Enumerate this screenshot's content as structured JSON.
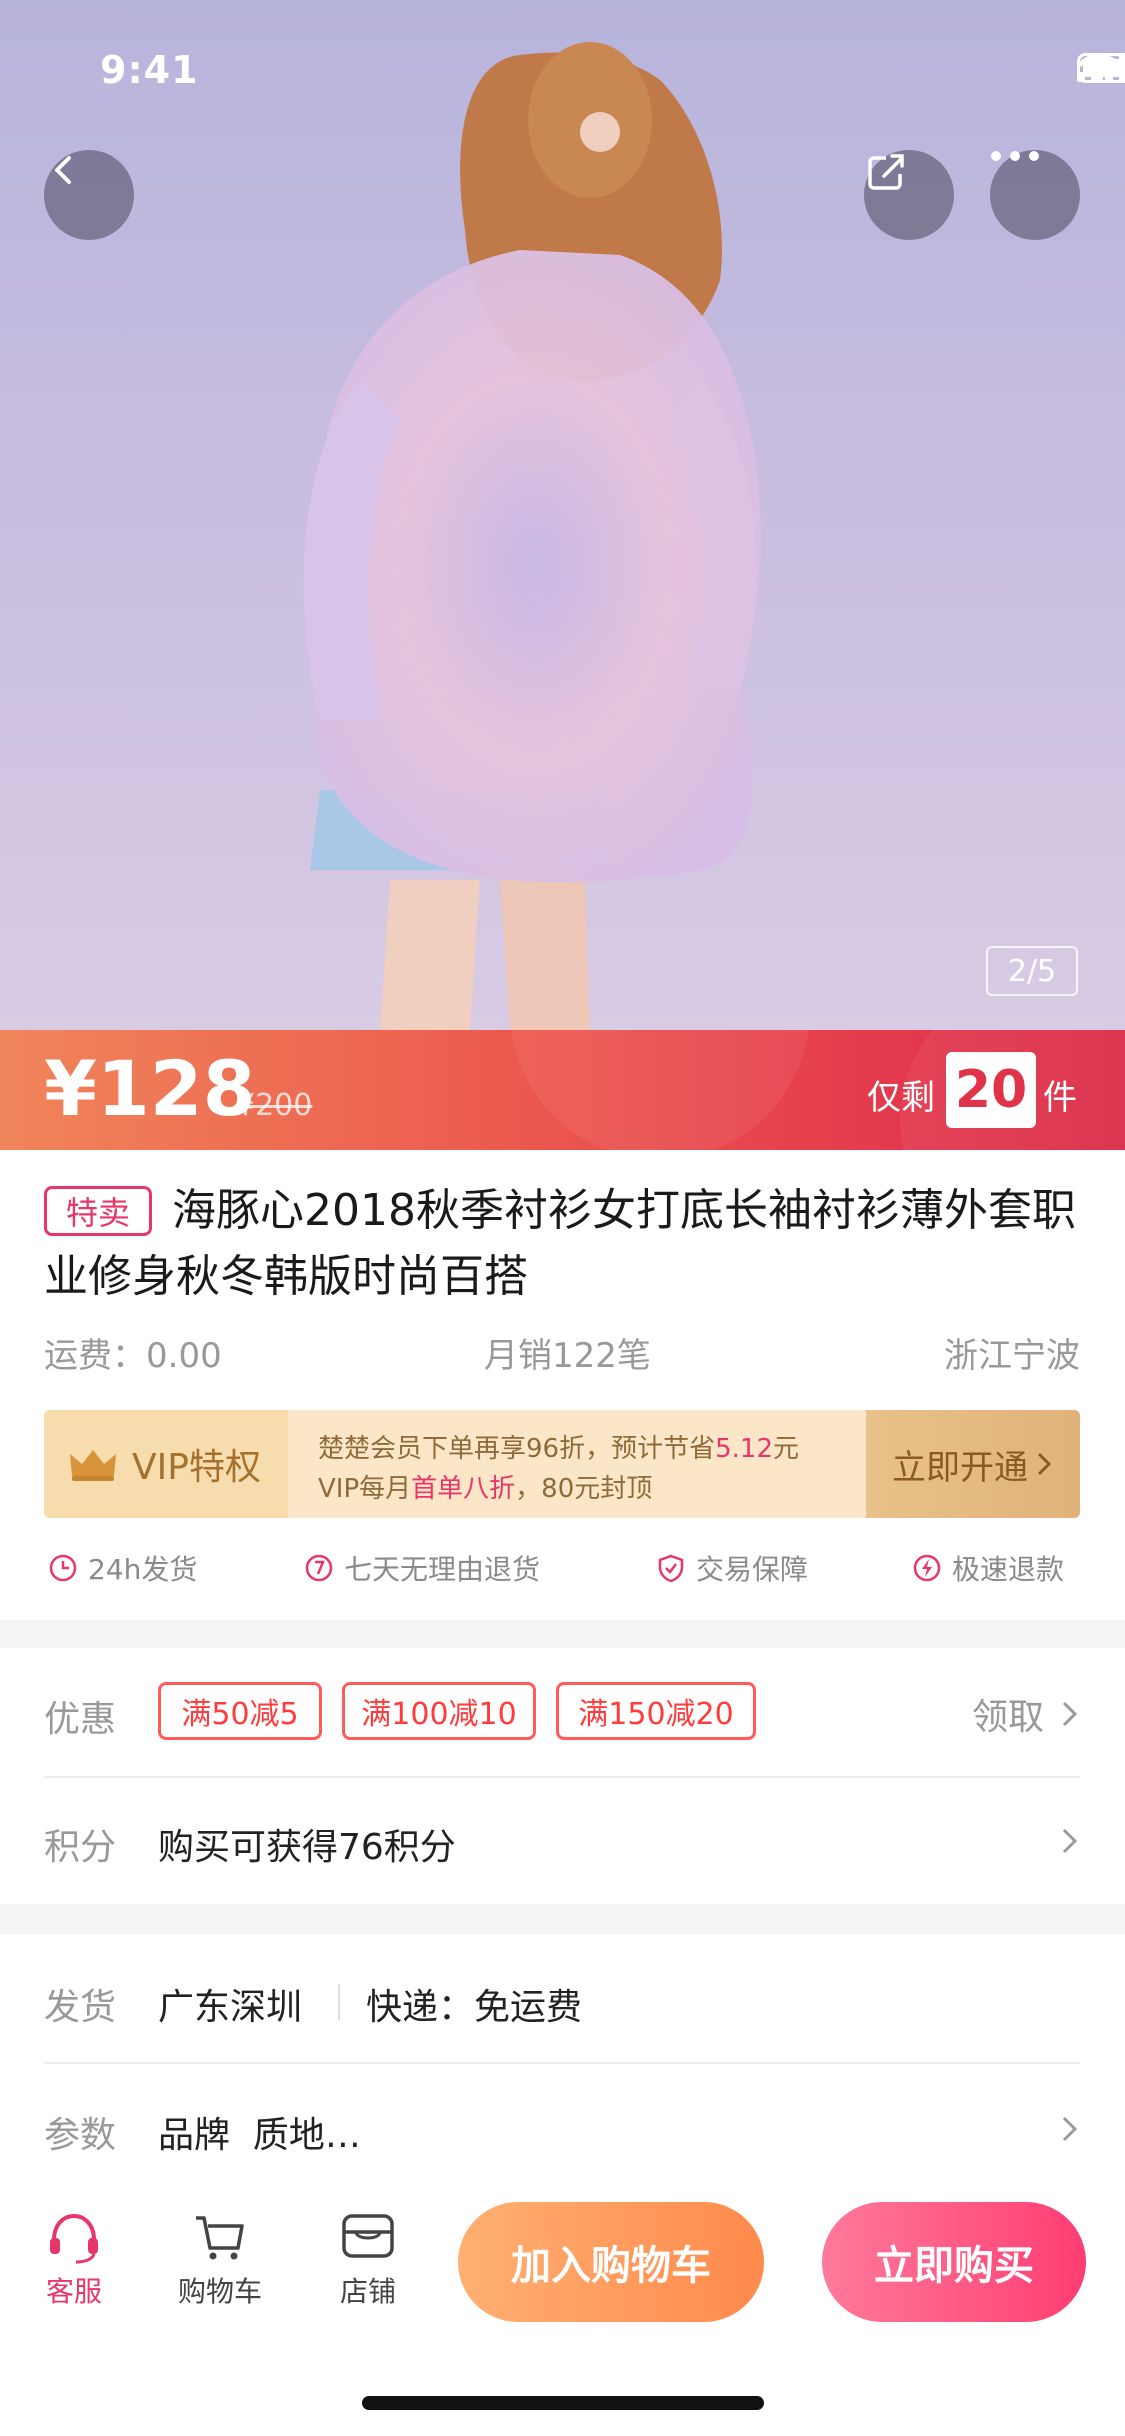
{
  "status": {
    "time": "9:41"
  },
  "hero": {
    "page_indicator": "2/5"
  },
  "price": {
    "current": "¥128",
    "original": "¥200",
    "stock_prefix": "仅剩",
    "stock_count": "20",
    "stock_suffix": "件"
  },
  "product": {
    "tag": "特卖",
    "title": "海豚心2018秋季衬衫女打底长袖衬衫薄外套职业修身秋冬韩版时尚百搭",
    "shipping_fee": "运费：0.00",
    "monthly_sales": "月销122笔",
    "location": "浙江宁波"
  },
  "vip": {
    "title": "VIP特权",
    "line1_pre": "楚楚会员下单再享96折，预计节省",
    "line1_hl": "5.12",
    "line1_post": "元",
    "line2_pre": "VIP每月",
    "line2_hl": "首单八折",
    "line2_post": "，80元封顶",
    "button": "立即开通"
  },
  "services": [
    "24h发货",
    "七天无理由退货",
    "交易保障",
    "极速退款"
  ],
  "promo": {
    "label": "优惠",
    "coupons": [
      "满50减5",
      "满100减10",
      "满150减20"
    ],
    "action": "领取"
  },
  "points": {
    "label": "积分",
    "text": "购买可获得76积分"
  },
  "delivery": {
    "label": "发货",
    "from": "广东深圳",
    "express": "快递：免运费"
  },
  "params": {
    "label": "参数",
    "text": "品牌  质地…"
  },
  "bottom_bar": {
    "service": "客服",
    "cart": "购物车",
    "store": "店铺",
    "add_to_cart": "加入购物车",
    "buy_now": "立即购买"
  },
  "colors": {
    "accent": "#e8356a",
    "price_bar": "#e4394d",
    "vip_gold": "#a6712d"
  }
}
